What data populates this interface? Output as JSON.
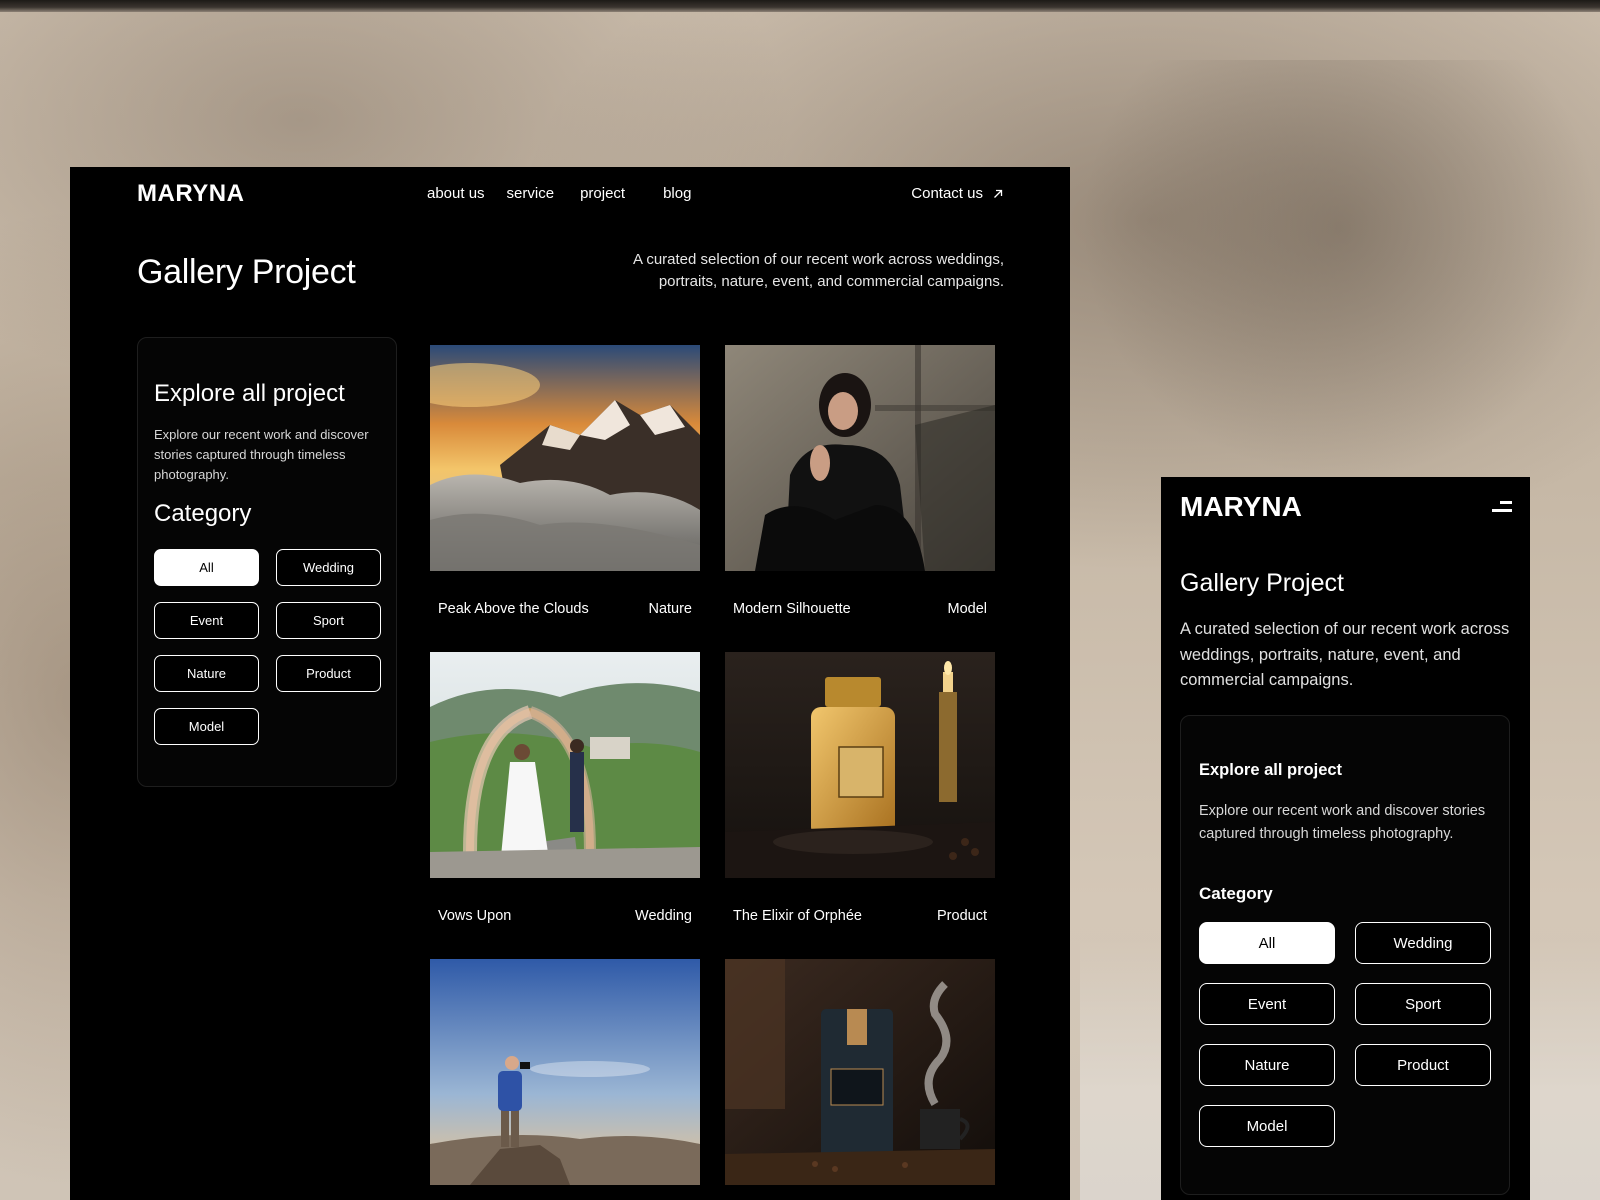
{
  "desktop": {
    "logo": "MARYNA",
    "nav": {
      "items": [
        "about us",
        "service",
        "project",
        "blog"
      ],
      "contact_label": "Contact us"
    },
    "title": "Gallery Project",
    "description_line1": "A curated selection of our recent work across weddings,",
    "description_line2": "portraits, nature, event, and commercial campaigns.",
    "sidebar": {
      "title": "Explore all project",
      "text": "Explore our recent work and discover stories captured through timeless photography.",
      "category_title": "Category",
      "categories": [
        "All",
        "Wedding",
        "Event",
        "Sport",
        "Nature",
        "Product",
        "Model"
      ],
      "active_category": "All"
    },
    "projects": [
      {
        "title": "Peak Above the Clouds",
        "category": "Nature"
      },
      {
        "title": "Modern Silhouette",
        "category": "Model"
      },
      {
        "title": "Vows Upon",
        "category": "Wedding"
      },
      {
        "title": "The Elixir of Orphée",
        "category": "Product"
      },
      {
        "title": "",
        "category": ""
      },
      {
        "title": "",
        "category": ""
      }
    ]
  },
  "mobile": {
    "logo": "MARYNA",
    "title": "Gallery Project",
    "description": "A curated selection of our recent work across weddings, portraits, nature, event, and commercial campaigns.",
    "box": {
      "title": "Explore all project",
      "text": "Explore our recent work and discover stories captured through timeless photography.",
      "category_title": "Category",
      "categories": [
        "All",
        "Wedding",
        "Event",
        "Sport",
        "Nature",
        "Product",
        "Model"
      ],
      "active_category": "All"
    }
  },
  "colors": {
    "panel_bg": "#000000",
    "text": "#ffffff",
    "backdrop": "#c9bcab"
  },
  "icons": [
    "arrow-up-right-icon",
    "menu-icon"
  ]
}
